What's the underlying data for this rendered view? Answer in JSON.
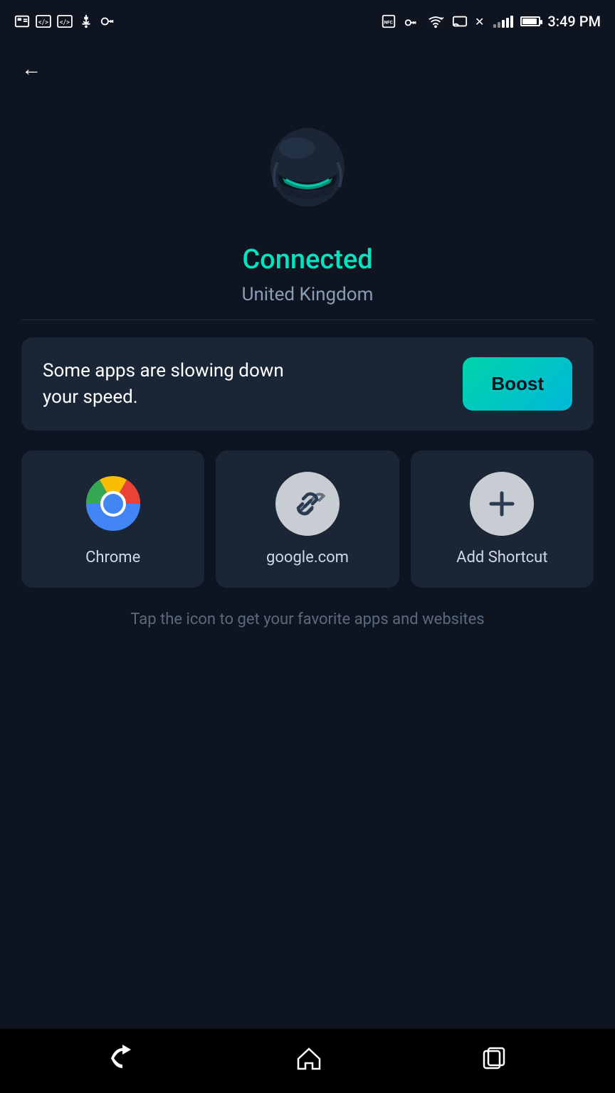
{
  "statusBar": {
    "time": "3:49 PM",
    "icons": [
      "screenshot",
      "code",
      "code2",
      "usb",
      "key",
      "nfc",
      "vpnkey",
      "wifi",
      "cast",
      "signal",
      "battery"
    ]
  },
  "navigation": {
    "backLabel": "←"
  },
  "hero": {
    "status": "Connected",
    "location": "United Kingdom"
  },
  "boostCard": {
    "message": "Some apps are slowing down your speed.",
    "buttonLabel": "Boost"
  },
  "shortcuts": [
    {
      "label": "Chrome",
      "type": "chrome"
    },
    {
      "label": "google.com",
      "type": "link"
    },
    {
      "label": "Add Shortcut",
      "type": "add"
    }
  ],
  "hintText": "Tap the icon to get your favorite apps and websites",
  "navBar": {
    "back": "↩",
    "home": "⌂",
    "recents": "⧉"
  },
  "colors": {
    "accent": "#00e5c0",
    "background": "#0e1521",
    "cardBg": "#1a2535",
    "textMuted": "#5a6a7e"
  }
}
